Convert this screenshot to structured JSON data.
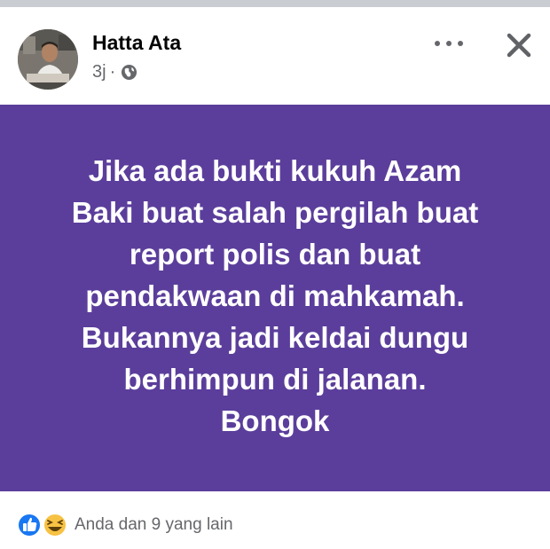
{
  "post": {
    "author": "Hatta Ata",
    "time": "3j",
    "separator": "·",
    "privacy_icon": "globe-icon",
    "text": "Jika ada bukti kukuh Azam\nBaki buat salah pergilah buat\nreport polis dan buat\npendakwaan di mahkamah.\nBukannya jadi keldai dungu\nberhimpun di jalanan.\nBongok",
    "background_color": "#5b3e9b"
  },
  "header": {
    "more_icon": "more-horizontal-icon",
    "close_icon": "close-icon"
  },
  "footer": {
    "reaction_icons": [
      "like-icon",
      "haha-icon"
    ],
    "reaction_summary": "Anda dan 9 yang lain"
  }
}
